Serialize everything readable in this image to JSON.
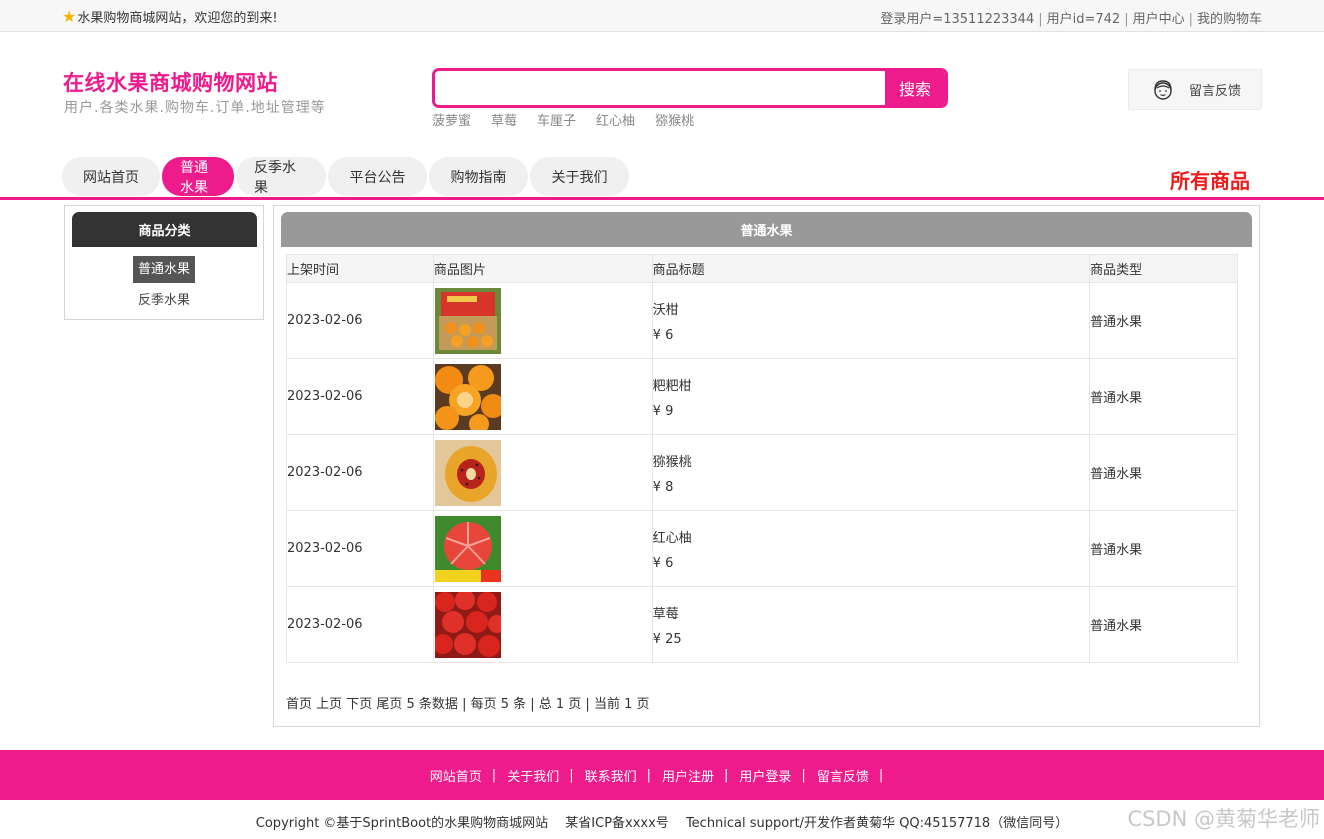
{
  "topbar": {
    "welcome": "水果购物商城网站，欢迎您的到来!",
    "links": [
      "登录用户=13511223344",
      "用户id=742",
      "用户中心",
      "我的购物车"
    ]
  },
  "header": {
    "title": "在线水果商城购物网站",
    "subtitle": "用户.各类水果.购物车.订单.地址管理等",
    "search_button": "搜索",
    "search_value": "",
    "hotwords": [
      "菠萝蜜",
      "草莓",
      "车厘子",
      "红心柚",
      "猕猴桃"
    ],
    "feedback": "留言反馈"
  },
  "nav": {
    "tabs": [
      "网站首页",
      "普通水果",
      "反季水果",
      "平台公告",
      "购物指南",
      "关于我们"
    ],
    "active": 1,
    "right_title": "所有商品"
  },
  "sidebar": {
    "title": "商品分类",
    "items": [
      "普通水果",
      "反季水果"
    ]
  },
  "main": {
    "title": "普通水果",
    "columns": [
      "上架时间",
      "商品图片",
      "商品标题",
      "商品类型"
    ],
    "rows": [
      {
        "date": "2023-02-06",
        "name": "沃柑",
        "price": "¥ 6",
        "type": "普通水果",
        "img": "orange-box"
      },
      {
        "date": "2023-02-06",
        "name": "粑粑柑",
        "price": "¥ 9",
        "type": "普通水果",
        "img": "tangerine"
      },
      {
        "date": "2023-02-06",
        "name": "猕猴桃",
        "price": "¥ 8",
        "type": "普通水果",
        "img": "kiwi"
      },
      {
        "date": "2023-02-06",
        "name": "红心柚",
        "price": "¥ 6",
        "type": "普通水果",
        "img": "pomelo"
      },
      {
        "date": "2023-02-06",
        "name": "草莓",
        "price": "¥ 25",
        "type": "普通水果",
        "img": "strawberry"
      }
    ],
    "pager": "首页 上页 下页 尾页 5 条数据 | 每页 5 条 | 总 1 页 | 当前 1 页"
  },
  "footer": {
    "links": [
      "网站首页",
      "关于我们",
      "联系我们",
      "用户注册",
      "用户登录",
      "留言反馈"
    ],
    "copyright": "Copyright ©基于SprintBoot的水果购物商城网站　 某省ICP备xxxx号　 Technical support/开发作者黄菊华 QQ:45157718（微信同号）",
    "watermark": "CSDN @黄菊华老师"
  },
  "colors": {
    "accent": "#ee1b8c",
    "accent_text_red": "#ee1b1b",
    "sidebar_head": "#333333",
    "panel_head": "#999999"
  }
}
